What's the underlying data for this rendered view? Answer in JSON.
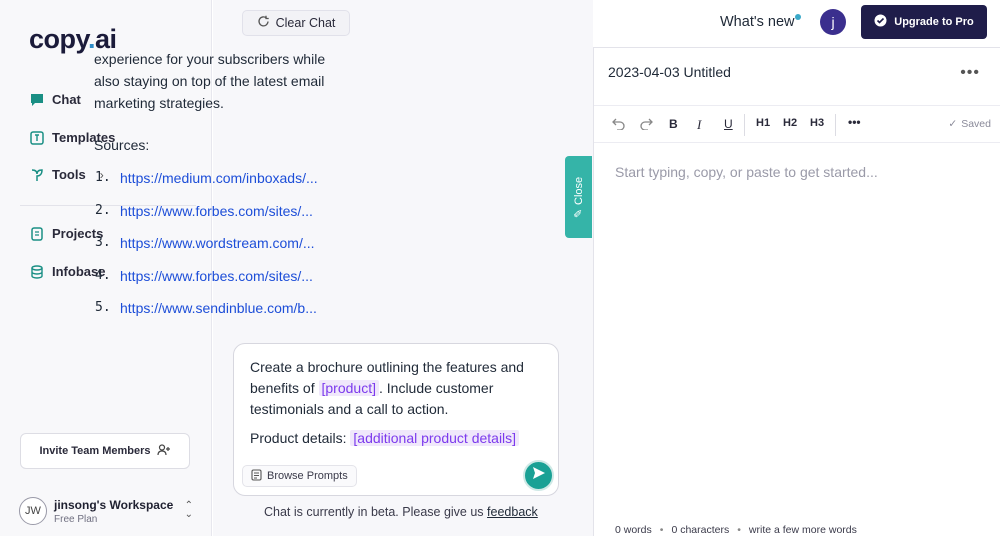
{
  "brand": {
    "logo_prefix": "copy",
    "logo_dot": ".",
    "logo_suffix": "ai",
    "accent": "#35b4a8",
    "primary": "#1f1d4a"
  },
  "sidebar": {
    "items": [
      {
        "label": "Chat",
        "icon": "chat-bubble-icon"
      },
      {
        "label": "Templates",
        "icon": "template-icon"
      },
      {
        "label": "Tools",
        "icon": "tools-icon"
      },
      {
        "label": "Projects",
        "icon": "document-icon"
      },
      {
        "label": "Infobase",
        "icon": "database-icon"
      }
    ],
    "invite_label": "Invite Team Members",
    "workspace": {
      "initials": "JW",
      "name": "jinsong's Workspace",
      "plan": "Free Plan"
    }
  },
  "chat": {
    "clear_label": "Clear Chat",
    "message_text": "experience for your subscribers while also staying on top of the latest email marketing strategies.",
    "sources_label": "Sources:",
    "sources": [
      {
        "num": "1.",
        "url": "https://medium.com/inboxads/..."
      },
      {
        "num": "2.",
        "url": "https://www.forbes.com/sites/..."
      },
      {
        "num": "3.",
        "url": "https://www.wordstream.com/..."
      },
      {
        "num": "4.",
        "url": "https://www.forbes.com/sites/..."
      },
      {
        "num": "5.",
        "url": "https://www.sendinblue.com/b..."
      }
    ],
    "close_label": "Close",
    "prompt": {
      "part1": "Create a brochure outlining the features and benefits of",
      "tag1": "[product]",
      "part2": ". Include customer testimonials and a call to action.",
      "details_label": "Product details:",
      "tag2": "[additional product details]"
    },
    "browse_label": "Browse Prompts",
    "beta_text": "Chat is currently in beta. Please give us",
    "beta_link": "feedback"
  },
  "header": {
    "whats_new": "What's new",
    "user_initial": "j",
    "upgrade_label": "Upgrade to Pro"
  },
  "editor": {
    "title": "2023-04-03 Untitled",
    "more": "•••",
    "toolbar": {
      "bold": "B",
      "italic": "I",
      "underline": "U",
      "h1": "H1",
      "h2": "H2",
      "h3": "H3",
      "more": "•••",
      "saved": "Saved"
    },
    "placeholder": "Start typing, copy, or paste to get started...",
    "status": {
      "words": "0 words",
      "characters": "0 characters",
      "hint": "write a few more words"
    }
  }
}
